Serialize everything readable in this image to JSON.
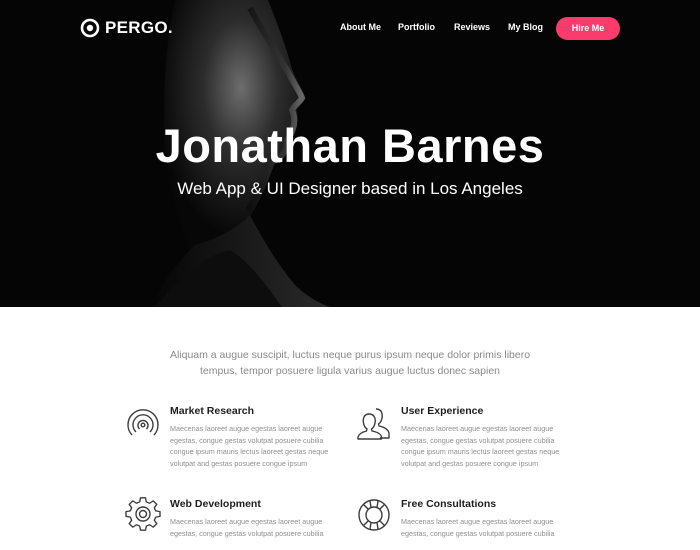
{
  "brand": {
    "name": "PERGO."
  },
  "nav": {
    "items": [
      "About Me",
      "Portfolio",
      "Reviews",
      "My Blog"
    ],
    "cta_label": "Hire Me",
    "cta_color": "#fb3a6e"
  },
  "hero": {
    "title": "Jonathan Barnes",
    "subtitle": "Web App & UI Designer based in Los Angeles"
  },
  "intro": {
    "line1": "Aliquam a augue suscipit, luctus neque purus ipsum neque dolor primis libero",
    "line2": "tempus, tempor posuere ligula varius augue luctus donec sapien"
  },
  "features": [
    {
      "icon": "target-icon",
      "title": "Market Research",
      "lines": [
        "Maecenas laoreet augue egestas laoreet augue",
        "egestas, congue gestas volutpat posuere cubilia",
        "congue ipsum mauris lectus laoreet gestas neque",
        "volutpat and gestas posuere congue ipsum"
      ]
    },
    {
      "icon": "users-icon",
      "title": "User Experience",
      "lines": [
        "Maecenas laoreet augue egestas laoreet augue",
        "egestas, congue gestas volutpat posuere cubilia",
        "congue ipsum mauris lectus laoreet gestas neque",
        "volutpat and gestas posuere congue ipsum"
      ]
    },
    {
      "icon": "gear-icon",
      "title": "Web Development",
      "lines": [
        "Maecenas laoreet augue egestas laoreet augue",
        "egestas, congue gestas volutpat posuere cubilia"
      ]
    },
    {
      "icon": "lifebuoy-icon",
      "title": "Free Consultations",
      "lines": [
        "Maecenas laoreet augue egestas laoreet augue",
        "egestas, congue gestas volutpat posuere cubilia"
      ]
    }
  ]
}
